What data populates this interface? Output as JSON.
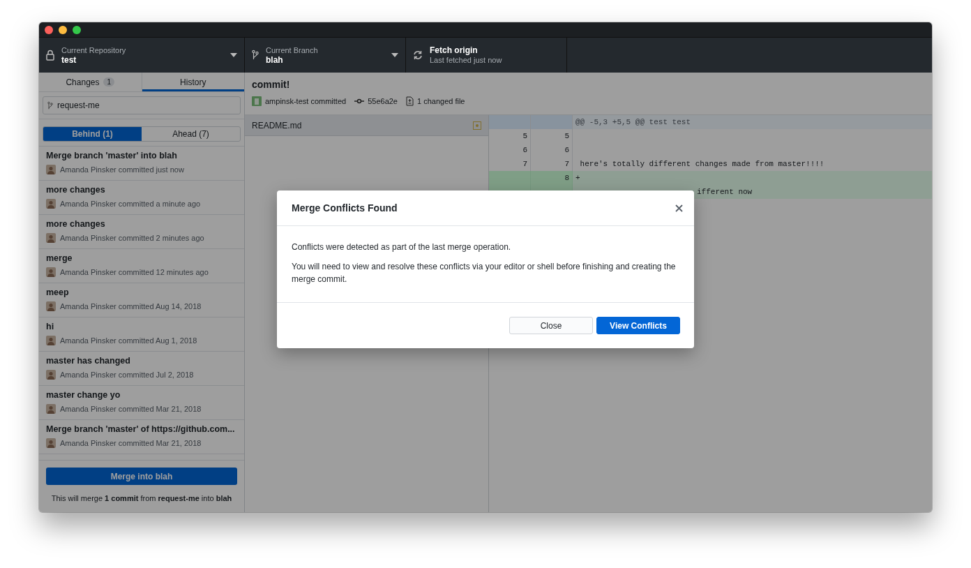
{
  "toolbar": {
    "repository": {
      "label": "Current Repository",
      "value": "test"
    },
    "branch": {
      "label": "Current Branch",
      "value": "blah"
    },
    "fetch": {
      "title": "Fetch origin",
      "subtitle": "Last fetched just now"
    }
  },
  "tabs": [
    {
      "label": "Changes",
      "badge": "1",
      "selected": false
    },
    {
      "label": "History",
      "selected": true
    }
  ],
  "branch_filter": {
    "value": "request-me"
  },
  "compare_tabs": [
    {
      "label": "Behind (1)",
      "selected": true
    },
    {
      "label": "Ahead (7)",
      "selected": false
    }
  ],
  "commits": [
    {
      "title": "Merge branch 'master' into blah",
      "meta": "Amanda Pinsker committed just now"
    },
    {
      "title": "more changes",
      "meta": "Amanda Pinsker committed a minute ago"
    },
    {
      "title": "more changes",
      "meta": "Amanda Pinsker committed 2 minutes ago"
    },
    {
      "title": "merge",
      "meta": "Amanda Pinsker committed 12 minutes ago"
    },
    {
      "title": "meep",
      "meta": "Amanda Pinsker committed Aug 14, 2018"
    },
    {
      "title": "hi",
      "meta": "Amanda Pinsker committed Aug 1, 2018"
    },
    {
      "title": "master has changed",
      "meta": "Amanda Pinsker committed Jul 2, 2018"
    },
    {
      "title": "master change yo",
      "meta": "Amanda Pinsker committed Mar 21, 2018"
    },
    {
      "title": "Merge branch 'master' of https://github.com...",
      "meta": "Amanda Pinsker committed Mar 21, 2018"
    }
  ],
  "merge_button": "Merge into blah",
  "merge_note": "This will merge **1 commit** from **request-me** into **blah**",
  "commit": {
    "title": "commit!",
    "author": "ampinsk-test committed",
    "sha": "55e6a2e",
    "files": "1 changed file"
  },
  "files": [
    {
      "name": "README.md",
      "kind": "modified"
    }
  ],
  "diff": [
    {
      "kind": "hunk",
      "text": "@@ -5,3 +5,5 @@ test test"
    },
    {
      "kind": "context",
      "old": "5",
      "new": "5"
    },
    {
      "kind": "context",
      "old": "6",
      "new": "6"
    },
    {
      "kind": "context",
      "old": "7",
      "new": "7",
      "text": " here's totally different changes made from master!!!!"
    },
    {
      "kind": "added",
      "new": "8",
      "text": "+"
    },
    {
      "kind": "added",
      "text": "ifferent now"
    }
  ],
  "dialog": {
    "title": "Merge Conflicts Found",
    "paragraphs": [
      "Conflicts were detected as part of the last merge operation.",
      "You will need to view and resolve these conflicts via your editor or shell before finishing and creating the merge commit."
    ],
    "buttons": [
      {
        "label": "Close",
        "kind": "secondary"
      },
      {
        "label": "View Conflicts",
        "kind": "primary"
      }
    ]
  }
}
